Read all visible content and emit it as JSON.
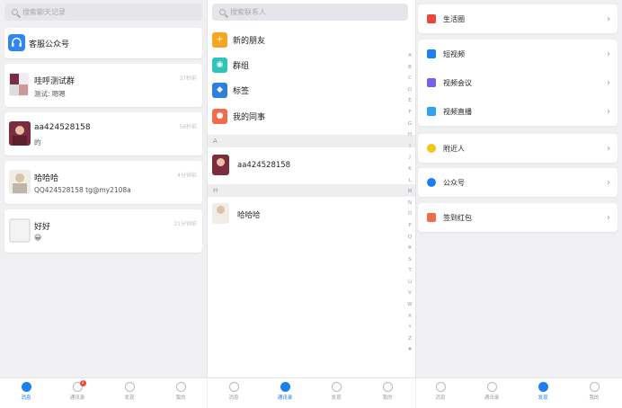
{
  "colors": {
    "accent": "#1d7ff0",
    "badge": "#f04a3a",
    "background": "#f0f0f2"
  },
  "messages": {
    "search_placeholder": "搜索聊天记录",
    "service_account": {
      "title": "客服公众号",
      "icon": "headset-icon"
    },
    "chats": [
      {
        "title": "哇呼测试群",
        "preview": "测试: 嗯嗯",
        "time": "37秒前"
      },
      {
        "title": "aa424528158",
        "preview": "的",
        "time": "56秒前"
      },
      {
        "title": "哈哈哈",
        "preview": "QQ424528158 tg@my2108a",
        "time": "4分钟前"
      },
      {
        "title": "好好",
        "preview": "😀",
        "time": "21分钟前"
      }
    ]
  },
  "contacts": {
    "search_placeholder": "搜索联系人",
    "menu": [
      {
        "label": "新的朋友",
        "icon": "add-user-icon",
        "color": "#f5a623"
      },
      {
        "label": "群组",
        "icon": "group-icon",
        "color": "#2ec4b6"
      },
      {
        "label": "标签",
        "icon": "tag-icon",
        "color": "#2f7fe0"
      },
      {
        "label": "我的同事",
        "icon": "colleague-icon",
        "color": "#f26b4a"
      }
    ],
    "sections": [
      {
        "letter": "A",
        "name": "aa424528158"
      },
      {
        "letter": "H",
        "name": "哈哈哈"
      }
    ],
    "alphabet": [
      "A",
      "B",
      "C",
      "D",
      "E",
      "F",
      "G",
      "H",
      "I",
      "J",
      "K",
      "L",
      "M",
      "N",
      "O",
      "P",
      "Q",
      "R",
      "S",
      "T",
      "U",
      "V",
      "W",
      "X",
      "Y",
      "Z",
      "#"
    ]
  },
  "discover": {
    "items": [
      {
        "label": "生活圈",
        "icon": "moments-icon",
        "color": "#e9473b"
      },
      {
        "label": "短视频",
        "icon": "video-icon",
        "color": "#1d7ff0"
      },
      {
        "label": "视频会议",
        "icon": "meeting-icon",
        "color": "#7a5cf0"
      },
      {
        "label": "视频直播",
        "icon": "live-icon",
        "color": "#2aa7f0"
      },
      {
        "label": "附近人",
        "icon": "nearby-icon",
        "color": "#f5c51a"
      },
      {
        "label": "公众号",
        "icon": "official-account-icon",
        "color": "#1d7ff0"
      },
      {
        "label": "签到红包",
        "icon": "red-packet-icon",
        "color": "#f26b4a"
      }
    ]
  },
  "tabbar": {
    "tabs": [
      "消息",
      "通讯录",
      "发现",
      "我的"
    ],
    "badge_count": "1"
  }
}
